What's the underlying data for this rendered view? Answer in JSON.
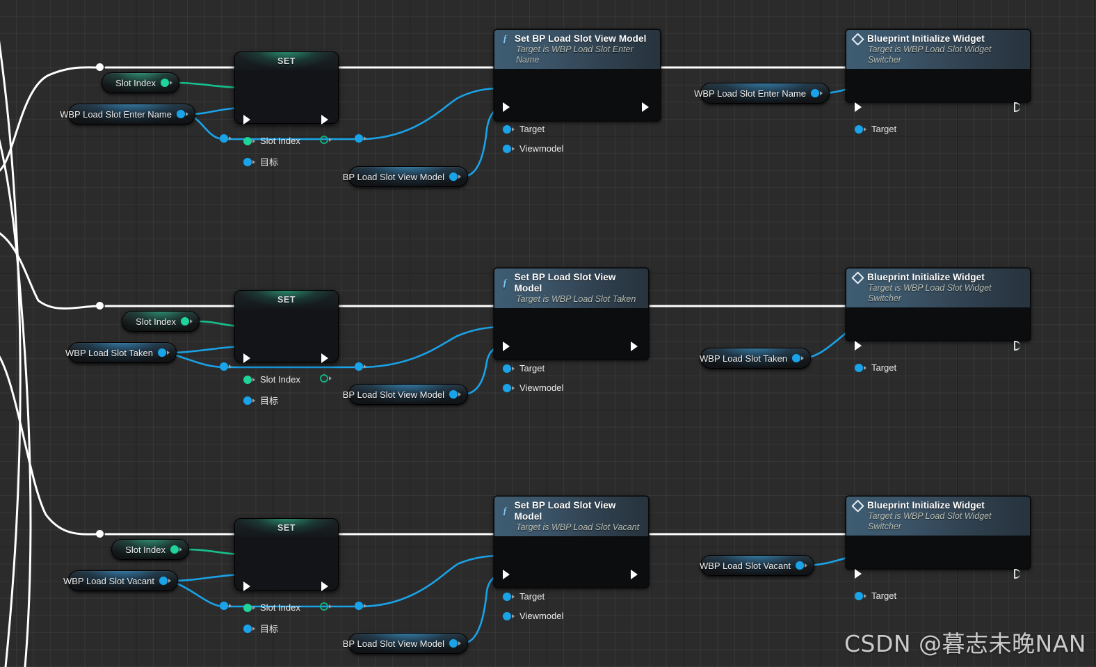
{
  "app": {
    "kind": "unreal-blueprint-graph",
    "watermark": "CSDN @暮志未晚NAN"
  },
  "colors": {
    "exec_wire": "#ffffff",
    "object_wire": "#1aa3e8",
    "int_wire": "#16c08c",
    "graph_background": "#2b2b2b",
    "function_header": "#3e5c72",
    "set_header_glow": "#32d7a0"
  },
  "labels": {
    "set_title": "SET",
    "slot_index": "Slot Index",
    "target_cjk": "目标",
    "target": "Target",
    "viewmodel": "Viewmodel",
    "function_icon": "f",
    "widget_icon": "diamond"
  },
  "rows": [
    {
      "id": "row-enter-name",
      "slot_index_getter": "Slot Index",
      "widget_getter": "WBP Load Slot Enter Name",
      "set_node": {
        "title": "SET",
        "pins": [
          "Slot Index",
          "目标"
        ]
      },
      "viewmodel_getter": "BP Load Slot View Model",
      "setter_node": {
        "title": "Set BP Load Slot View Model",
        "subtitle": "Target is WBP Load Slot Enter Name",
        "icon": "f",
        "pins": [
          "Target",
          "Viewmodel"
        ]
      },
      "target_getter": "WBP Load Slot Enter Name",
      "init_node": {
        "title": "Blueprint Initialize Widget",
        "subtitle": "Target is WBP Load Slot Widget Switcher",
        "icon": "diamond",
        "pins": [
          "Target"
        ]
      }
    },
    {
      "id": "row-taken",
      "slot_index_getter": "Slot Index",
      "widget_getter": "WBP Load Slot Taken",
      "set_node": {
        "title": "SET",
        "pins": [
          "Slot Index",
          "目标"
        ]
      },
      "viewmodel_getter": "BP Load Slot View Model",
      "setter_node": {
        "title": "Set BP Load Slot View Model",
        "subtitle": "Target is WBP Load Slot Taken",
        "icon": "f",
        "pins": [
          "Target",
          "Viewmodel"
        ]
      },
      "target_getter": "WBP Load Slot Taken",
      "init_node": {
        "title": "Blueprint Initialize Widget",
        "subtitle": "Target is WBP Load Slot Widget Switcher",
        "icon": "diamond",
        "pins": [
          "Target"
        ]
      }
    },
    {
      "id": "row-vacant",
      "slot_index_getter": "Slot Index",
      "widget_getter": "WBP Load Slot Vacant",
      "set_node": {
        "title": "SET",
        "pins": [
          "Slot Index",
          "目标"
        ]
      },
      "viewmodel_getter": "BP Load Slot View Model",
      "setter_node": {
        "title": "Set BP Load Slot View Model",
        "subtitle": "Target is WBP Load Slot Vacant",
        "icon": "f",
        "pins": [
          "Target",
          "Viewmodel"
        ]
      },
      "target_getter": "WBP Load Slot Vacant",
      "init_node": {
        "title": "Blueprint Initialize Widget",
        "subtitle": "Target is WBP Load Slot Widget Switcher",
        "icon": "diamond",
        "pins": [
          "Target"
        ]
      }
    }
  ]
}
